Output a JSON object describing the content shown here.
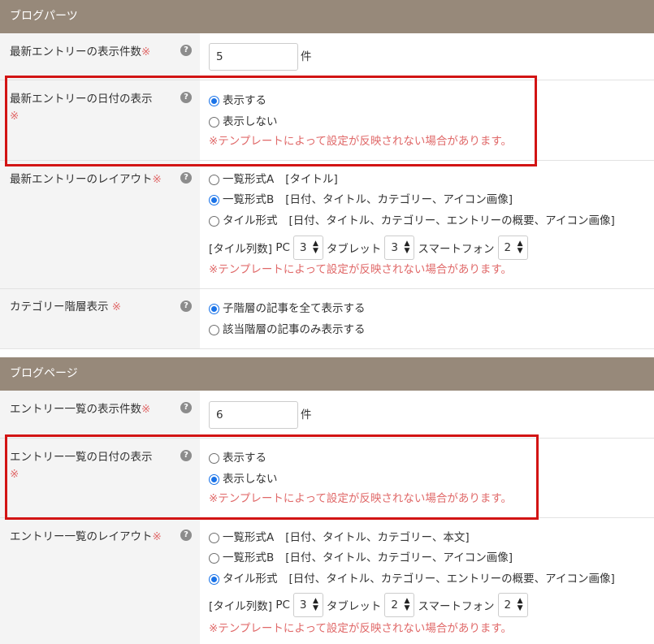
{
  "sections": [
    {
      "title": "ブログパーツ",
      "rows": [
        {
          "label": "最新エントリーの表示件数",
          "required": "※",
          "input_value": "5",
          "unit": "件"
        },
        {
          "label": "最新エントリーの日付の表示",
          "required": "※",
          "options": [
            "表示する",
            "表示しない"
          ],
          "selected": "表示する",
          "note": "※テンプレートによって設定が反映されない場合があります。"
        },
        {
          "label": "最新エントリーのレイアウト",
          "required": "※",
          "options": [
            {
              "label": "一覧形式A",
              "desc": "[タイトル]"
            },
            {
              "label": "一覧形式B",
              "desc": "[日付、タイトル、カテゴリー、アイコン画像]"
            },
            {
              "label": "タイル形式",
              "desc": "[日付、タイトル、カテゴリー、エントリーの概要、アイコン画像]"
            }
          ],
          "selected": "一覧形式B",
          "tile_cols_label": "[タイル列数]",
          "pc_label": "PC",
          "pc_value": "3",
          "tablet_label": "タブレット",
          "tablet_value": "3",
          "smartphone_label": "スマートフォン",
          "smartphone_value": "2",
          "note": "※テンプレートによって設定が反映されない場合があります。"
        },
        {
          "label": "カテゴリー階層表示",
          "required": "※",
          "options": [
            "子階層の記事を全て表示する",
            "該当階層の記事のみ表示する"
          ],
          "selected": "子階層の記事を全て表示する"
        }
      ]
    },
    {
      "title": "ブログページ",
      "rows": [
        {
          "label": "エントリー一覧の表示件数",
          "required": "※",
          "input_value": "6",
          "unit": "件"
        },
        {
          "label": "エントリー一覧の日付の表示",
          "required": "※",
          "options": [
            "表示する",
            "表示しない"
          ],
          "selected": "表示しない",
          "note": "※テンプレートによって設定が反映されない場合があります。"
        },
        {
          "label": "エントリー一覧のレイアウト",
          "required": "※",
          "options": [
            {
              "label": "一覧形式A",
              "desc": "[日付、タイトル、カテゴリー、本文]"
            },
            {
              "label": "一覧形式B",
              "desc": "[日付、タイトル、カテゴリー、アイコン画像]"
            },
            {
              "label": "タイル形式",
              "desc": "[日付、タイトル、カテゴリー、エントリーの概要、アイコン画像]"
            }
          ],
          "selected": "タイル形式",
          "tile_cols_label": "[タイル列数]",
          "pc_label": "PC",
          "pc_value": "3",
          "tablet_label": "タブレット",
          "tablet_value": "2",
          "smartphone_label": "スマートフォン",
          "smartphone_value": "2",
          "note": "※テンプレートによって設定が反映されない場合があります。"
        }
      ]
    }
  ],
  "help_icon_glyph": "?",
  "colors": {
    "section_header": "#97897a",
    "label_bg": "#f4f4f4",
    "required": "#e06969",
    "highlight": "#d21414",
    "radio_selected": "#1a73e8"
  }
}
